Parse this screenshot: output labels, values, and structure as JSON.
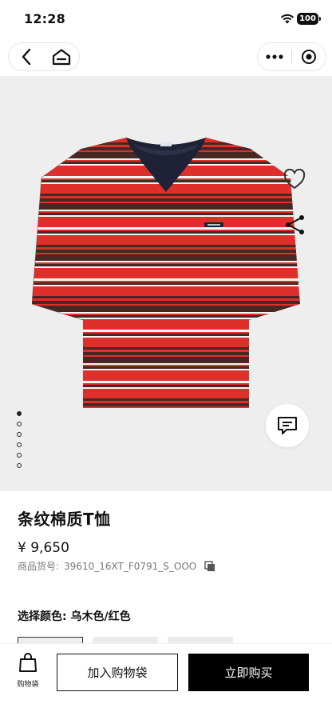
{
  "status_bar": {
    "time": "12:28",
    "battery": "100"
  },
  "nav": {
    "back_icon": "chevron-left-icon",
    "home_icon": "home-icon",
    "more_icon": "more-dots-icon",
    "close_icon": "target-close-icon"
  },
  "gallery": {
    "image_icon": "striped-tshirt",
    "dot_count": 6,
    "active_dot": 1,
    "colors": {
      "red": "#e8312c",
      "brown": "#4a2a24",
      "navy": "#1f2236",
      "white": "#ffffff",
      "background": "#eeeeee"
    }
  },
  "product": {
    "title": "条纹棉质T恤",
    "price": "¥ 9,650",
    "sku_label": "商品货号:",
    "sku": "39610_16XT_F0791_S_OOO"
  },
  "color_select": {
    "label": "选择颜色: 乌木色/红色",
    "swatch_count": 3,
    "selected": 0
  },
  "bottom_bar": {
    "cart_label": "购物袋",
    "add_to_cart": "加入购物袋",
    "buy_now": "立即购买"
  }
}
